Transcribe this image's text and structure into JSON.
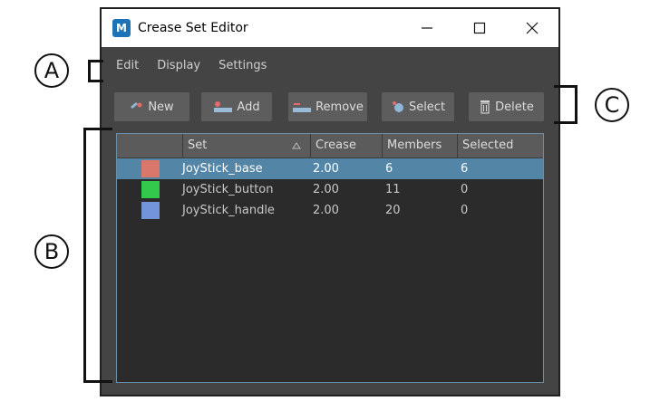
{
  "window": {
    "title": "Crease Set Editor",
    "app_icon_text": "M"
  },
  "menu": {
    "items": [
      {
        "label": "Edit"
      },
      {
        "label": "Display"
      },
      {
        "label": "Settings"
      }
    ]
  },
  "toolbar": {
    "new_label": "New",
    "add_label": "Add",
    "remove_label": "Remove",
    "select_label": "Select",
    "delete_label": "Delete"
  },
  "table": {
    "columns": [
      "Set",
      "Crease",
      "Members",
      "Selected"
    ],
    "rows": [
      {
        "color": "#d9776b",
        "set": "JoyStick_base",
        "crease": "2.00",
        "members": "6",
        "selected": "6"
      },
      {
        "color": "#33c94d",
        "set": "JoyStick_button",
        "crease": "2.00",
        "members": "11",
        "selected": "0"
      },
      {
        "color": "#7394d9",
        "set": "JoyStick_handle",
        "crease": "2.00",
        "members": "20",
        "selected": "0"
      }
    ]
  },
  "annotations": {
    "a": "A",
    "b": "B",
    "c": "C"
  },
  "colors": {
    "window_bg": "#444444",
    "selection": "#5285a6",
    "table_border": "#6a8fa6"
  },
  "icons": {
    "new": "new-set-icon",
    "add": "add-members-icon",
    "remove": "remove-members-icon",
    "select": "select-members-icon",
    "delete": "trash-icon"
  }
}
